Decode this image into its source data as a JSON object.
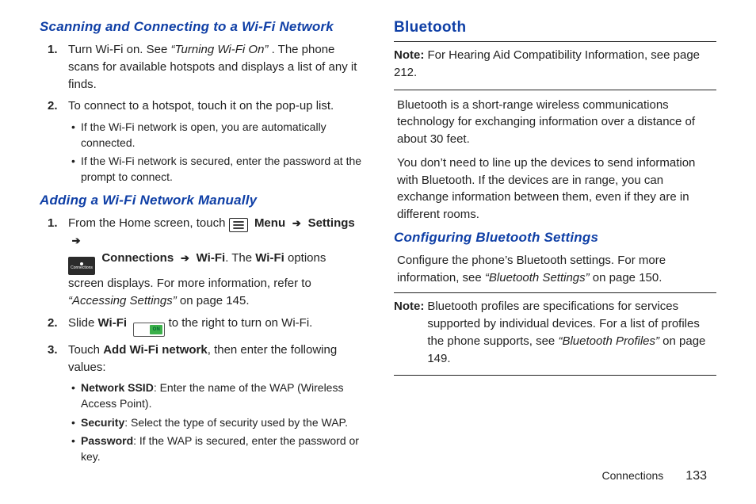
{
  "left": {
    "h1": "Scanning and Connecting to a Wi-Fi Network",
    "ol1": {
      "n1": "1.",
      "i1_pre": "Turn Wi-Fi on. See ",
      "i1_ref": "“Turning Wi-Fi On”",
      "i1_post": " . The phone scans for available hotspots and displays a list of any it finds.",
      "n2": "2.",
      "i2": "To connect to a hotspot, touch it on the pop-up list.",
      "b1": "If the Wi-Fi network is open, you are automatically connected.",
      "b2": "If the Wi-Fi network is secured, enter the password at the prompt to connect."
    },
    "h2": "Adding a Wi-Fi Network Manually",
    "ol2": {
      "n1": "1.",
      "i1_a": "From the Home screen, touch ",
      "menu_label": "Menu",
      "conn_name": "Connections",
      "settings": "Settings",
      "connections": "Connections",
      "wifi": "Wi-Fi",
      "i1_b": ". The ",
      "wifi_bold": "Wi-Fi",
      "i1_c": " options screen displays. For more information, refer to ",
      "i1_ref": "“Accessing Settings”",
      "i1_d": " on page 145.",
      "n2": "2.",
      "i2_a": "Slide ",
      "i2_wifi": "Wi-Fi",
      "toggle_text": "ON",
      "i2_b": " to the right to turn on Wi-Fi.",
      "n3": "3.",
      "i3_a": "Touch ",
      "i3_add": "Add Wi-Fi network",
      "i3_b": ", then enter the following values:",
      "b1_k": "Network SSID",
      "b1_v": ": Enter the name of the WAP (Wireless Access Point).",
      "b2_k": "Security",
      "b2_v": ": Select the type of security used by the WAP.",
      "b3_k": "Password",
      "b3_v": ": If the WAP is secured, enter the password or key."
    }
  },
  "right": {
    "h1": "Bluetooth",
    "note1_label": "Note:",
    "note1_text": " For Hearing Aid Compatibility Information, see page 212.",
    "p1": "Bluetooth is a short-range wireless communications technology for exchanging information over a distance of about 30 feet.",
    "p2": "You don’t need to line up the devices to send information with Bluetooth. If the devices are in range, you can exchange information between them, even if they are in different rooms.",
    "h2": "Configuring Bluetooth Settings",
    "p3_a": "Configure the phone’s Bluetooth settings. For more information, see ",
    "p3_ref": "“Bluetooth Settings”",
    "p3_b": " on page 150.",
    "note2_label": "Note:",
    "note2_a": "Bluetooth profiles are specifications for services supported by individual devices. For a list of profiles the phone supports, see ",
    "note2_ref": "“Bluetooth Profiles”",
    "note2_b": " on page 149."
  },
  "footer": {
    "section": "Connections",
    "page": "133"
  }
}
